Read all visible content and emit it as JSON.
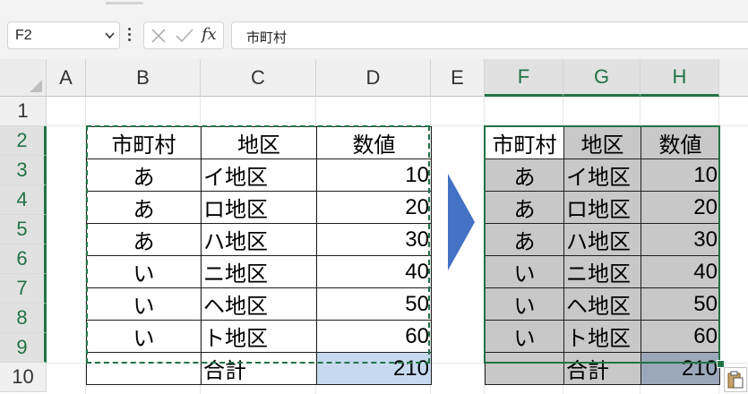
{
  "formula_bar": {
    "name_box": "F2",
    "fx_label": "fx",
    "content": "市町村"
  },
  "column_headers": [
    "A",
    "B",
    "C",
    "D",
    "E",
    "F",
    "G",
    "H"
  ],
  "selected_columns": [
    "F",
    "G",
    "H"
  ],
  "row_headers": [
    "1",
    "2",
    "3",
    "4",
    "5",
    "6",
    "7",
    "8",
    "9",
    "10"
  ],
  "selected_rows": [
    "2",
    "3",
    "4",
    "5",
    "6",
    "7",
    "8",
    "9"
  ],
  "source_table": {
    "headers": [
      "市町村",
      "地区",
      "数値"
    ],
    "rows": [
      [
        "あ",
        "イ地区",
        "10"
      ],
      [
        "あ",
        "ロ地区",
        "20"
      ],
      [
        "あ",
        "ハ地区",
        "30"
      ],
      [
        "い",
        "ニ地区",
        "40"
      ],
      [
        "い",
        "ヘ地区",
        "50"
      ],
      [
        "い",
        "ト地区",
        "60"
      ],
      [
        "",
        "合計",
        "210"
      ]
    ]
  },
  "pasted_table": {
    "headers": [
      "市町村",
      "地区",
      "数値"
    ],
    "rows": [
      [
        "あ",
        "イ地区",
        "10"
      ],
      [
        "あ",
        "ロ地区",
        "20"
      ],
      [
        "あ",
        "ハ地区",
        "30"
      ],
      [
        "い",
        "ニ地区",
        "40"
      ],
      [
        "い",
        "ヘ地区",
        "50"
      ],
      [
        "い",
        "ト地区",
        "60"
      ],
      [
        "",
        "合計",
        "210"
      ]
    ]
  },
  "colors": {
    "accent_green": "#217346",
    "arrow_blue": "#4472c4",
    "source_total_fill": "#c6d9ef",
    "pasted_fill_gray": "#c8c8c8",
    "pasted_total_fill": "#9aa8ba"
  },
  "icons": {
    "name_box_dropdown": "chevron-down-icon",
    "cancel": "close-icon",
    "confirm": "check-icon",
    "arrow": "arrow-right-icon",
    "paste_options": "clipboard-paste-icon"
  }
}
